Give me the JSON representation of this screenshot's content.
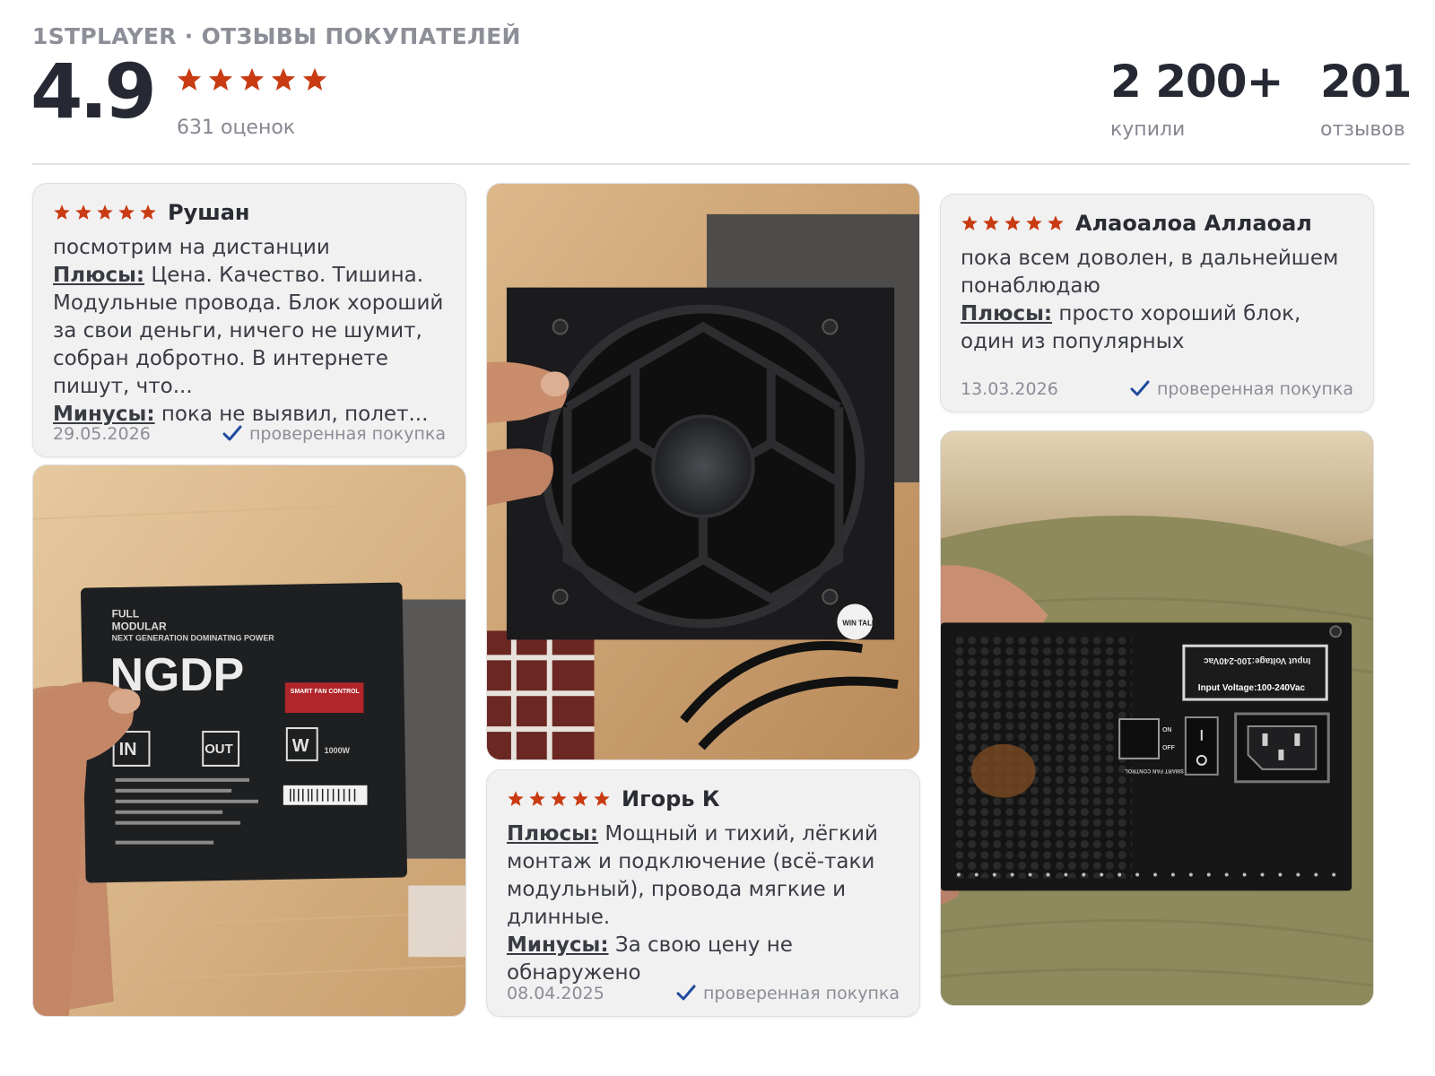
{
  "header": {
    "brand": "1STPLAYER · ОТЗЫВЫ ПОКУПАТЕЛЕЙ",
    "score": "4.9",
    "stars": 5,
    "ratings_label": "631 оценок",
    "bought_value": "2 200+",
    "bought_label": "купили",
    "reviews_value": "201",
    "reviews_label": "отзывов"
  },
  "colors": {
    "star": "#c93b12",
    "check": "#1f4a9c",
    "card_bg": "#f1f1f2"
  },
  "icons": {
    "star": "star-icon",
    "check": "checkmark-icon"
  },
  "reviews": [
    {
      "author": "Рушан",
      "stars": 5,
      "text": "посмотрим на дистанции",
      "pros_label": "Плюсы:",
      "pros": "Цена. Качество. Тишина. Модульные провода. Блок хороший за свои деньги, ничего не шумит, собран добротно. В интернете пишут, что...",
      "cons_label": "Минусы:",
      "cons": "пока не выявил, полет...",
      "date": "29.05.2026",
      "verified": "проверенная покупка"
    },
    {
      "author": "Алаоалоа Аллаоал",
      "stars": 5,
      "text": "пока всем доволен, в дальнейшем понаблюдаю",
      "pros_label": "Плюсы:",
      "pros": "просто хороший блок, один из популярных",
      "date": "13.03.2026",
      "verified": "проверенная покупка"
    },
    {
      "author": "Игорь К",
      "stars": 5,
      "pros_label": "Плюсы:",
      "pros": "Мощный и тихий, лёгкий монтаж и подключение (всё-таки модульный), провода мягкие и длинные.",
      "cons_label": "Минусы:",
      "cons": "За свою цену не обнаружено",
      "date": "08.04.2025",
      "verified": "проверенная покупка"
    }
  ],
  "photos": {
    "box": {
      "printed_label_1": "FULL",
      "printed_label_2": "MODULAR",
      "printed_tagline": "NEXT GENERATION DOMINATING POWER",
      "printed_model": "NGDP",
      "printed_in": "IN",
      "printed_out": "OUT",
      "printed_w": "W",
      "printed_fan": "SMART FAN CONTROL",
      "printed_watt": "1000W"
    },
    "fan": {
      "printed_sticker": "WIN TALK"
    },
    "back": {
      "printed_voltage": "Input Voltage:100-240Vac",
      "printed_voltage_mirrored": "Input Voltage:100-240Vac",
      "printed_switch": "SMART FAN CONTROL",
      "printed_on": "ON",
      "printed_off": "OFF"
    }
  }
}
